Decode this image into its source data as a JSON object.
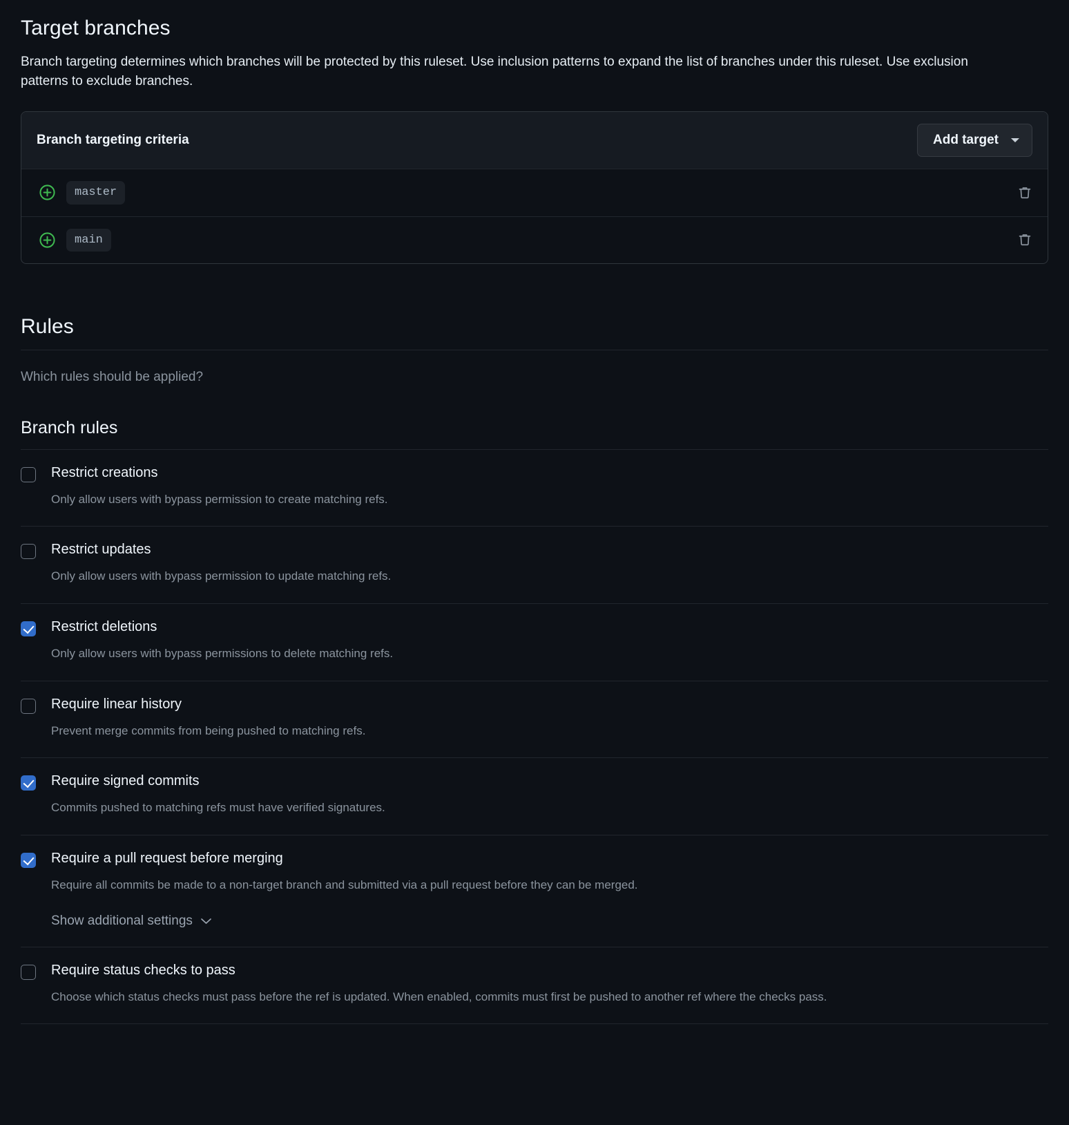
{
  "target_branches": {
    "title": "Target branches",
    "description": "Branch targeting determines which branches will be protected by this ruleset. Use inclusion patterns to expand the list of branches under this ruleset. Use exclusion patterns to exclude branches.",
    "card": {
      "header_title": "Branch targeting criteria",
      "add_target_label": "Add target",
      "caret_icon": "chevron-down-icon",
      "rows": [
        {
          "include_icon": "plus-circle-icon",
          "branch": "master",
          "delete_icon": "trash-icon"
        },
        {
          "include_icon": "plus-circle-icon",
          "branch": "main",
          "delete_icon": "trash-icon"
        }
      ]
    }
  },
  "rules": {
    "title": "Rules",
    "subtitle": "Which rules should be applied?",
    "branch_rules_title": "Branch rules",
    "items": [
      {
        "label": "Restrict creations",
        "description": "Only allow users with bypass permission to create matching refs.",
        "checked": false
      },
      {
        "label": "Restrict updates",
        "description": "Only allow users with bypass permission to update matching refs.",
        "checked": false
      },
      {
        "label": "Restrict deletions",
        "description": "Only allow users with bypass permissions to delete matching refs.",
        "checked": true
      },
      {
        "label": "Require linear history",
        "description": "Prevent merge commits from being pushed to matching refs.",
        "checked": false
      },
      {
        "label": "Require signed commits",
        "description": "Commits pushed to matching refs must have verified signatures.",
        "checked": true
      },
      {
        "label": "Require a pull request before merging",
        "description": "Require all commits be made to a non-target branch and submitted via a pull request before they can be merged.",
        "checked": true,
        "show_additional_settings_label": "Show additional settings",
        "show_additional_settings_icon": "chevron-down-icon"
      },
      {
        "label": "Require status checks to pass",
        "description": "Choose which status checks must pass before the ref is updated. When enabled, commits must first be pushed to another ref where the checks pass.",
        "checked": false
      }
    ]
  },
  "colors": {
    "background": "#0d1117",
    "accent_checked": "#316dca",
    "include_icon_green": "#3fb950",
    "muted_text": "#8b949e",
    "border": "#30363d"
  }
}
